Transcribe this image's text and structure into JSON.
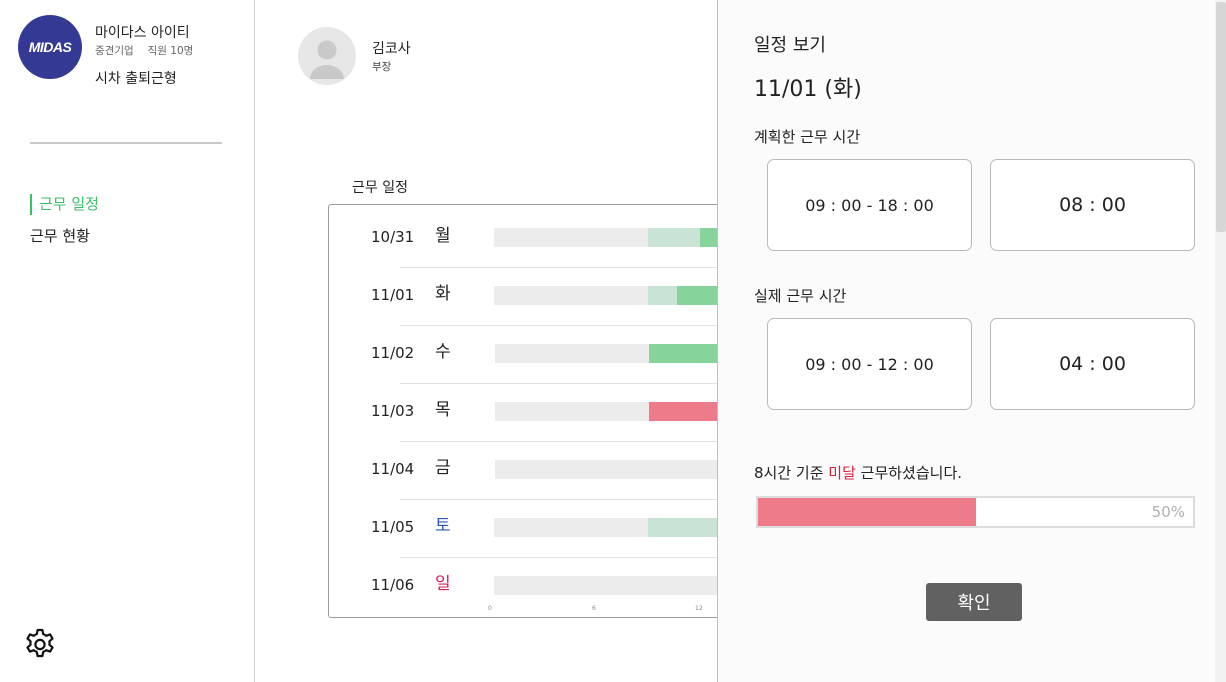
{
  "company": {
    "logo_text": "MIDAS",
    "name": "마이다스 아이티",
    "size": "중견기업",
    "employees": "직원 10명",
    "work_type": "시차 출퇴근형"
  },
  "sidebar": {
    "items": [
      {
        "label": "근무 일정",
        "active": true
      },
      {
        "label": "근무 현황",
        "active": false
      }
    ]
  },
  "user": {
    "name": "김코사",
    "role": "부장"
  },
  "schedule": {
    "title": "근무 일정",
    "axis_ticks": [
      "0",
      "6",
      "12"
    ],
    "rows": [
      {
        "date": "10/31",
        "day": "월",
        "day_type": "weekday"
      },
      {
        "date": "11/01",
        "day": "화",
        "day_type": "weekday"
      },
      {
        "date": "11/02",
        "day": "수",
        "day_type": "weekday"
      },
      {
        "date": "11/03",
        "day": "목",
        "day_type": "weekday"
      },
      {
        "date": "11/04",
        "day": "금",
        "day_type": "weekday"
      },
      {
        "date": "11/05",
        "day": "토",
        "day_type": "saturday"
      },
      {
        "date": "11/06",
        "day": "일",
        "day_type": "sunday"
      }
    ]
  },
  "panel": {
    "title": "일정 보기",
    "date": "11/01 (화)",
    "planned_label": "계획한 근무 시간",
    "planned_range": "09 : 00 - 18 : 00",
    "planned_duration": "08 : 00",
    "actual_label": "실제 근무 시간",
    "actual_range": "09 : 00 - 12 : 00",
    "actual_duration": "04 : 00",
    "notice_prefix": "8시간 기준 ",
    "notice_highlight": "미달",
    "notice_suffix": " 근무하셨습니다.",
    "progress_percent": 50,
    "progress_text": "50%",
    "confirm_label": "확인"
  },
  "colors": {
    "accent_green": "#3bbf64",
    "planned_bar": "#c9e3d5",
    "actual_bar": "#86d49b",
    "shortfall": "#ee7b89",
    "saturday": "#2b56b5",
    "sunday": "#d81f5a",
    "logo": "#343a94"
  }
}
